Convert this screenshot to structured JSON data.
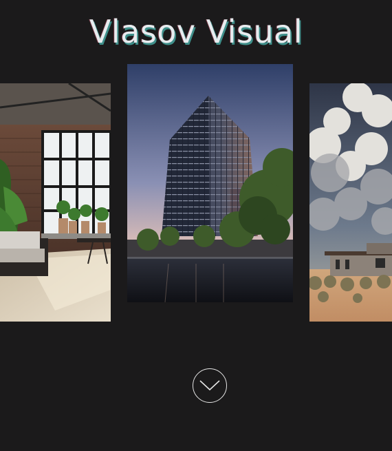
{
  "site": {
    "title": "Vlasov Visual"
  },
  "carousel": {
    "slides": [
      {
        "name": "loft-bedroom-render",
        "position": "left"
      },
      {
        "name": "residential-tower-render",
        "position": "center",
        "active": true
      },
      {
        "name": "desert-house-render",
        "position": "right"
      }
    ]
  },
  "scroll_button": {
    "icon": "chevron-down-icon"
  },
  "colors": {
    "background": "#1b1a1b",
    "title": "#e8ecef",
    "title_shadow": "#3f8f8a"
  }
}
